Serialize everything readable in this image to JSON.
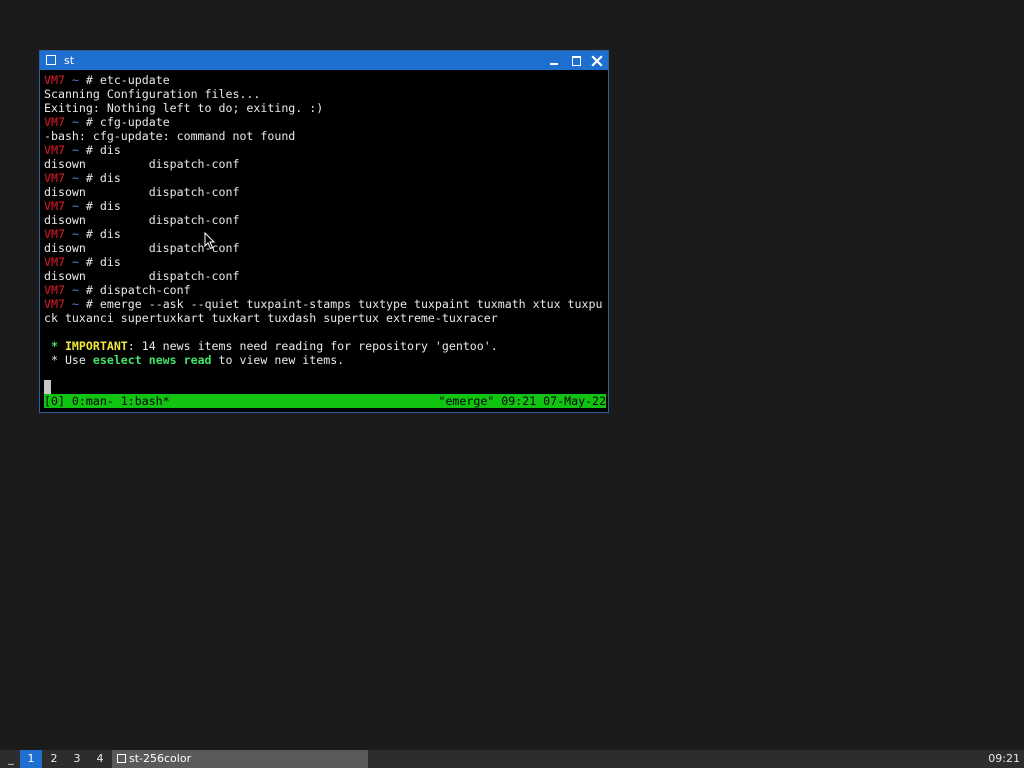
{
  "window": {
    "title": "st",
    "icons": {
      "app": "window-icon",
      "minimize": "minimize-icon",
      "maximize": "maximize-icon",
      "close": "close-icon"
    }
  },
  "prompt": {
    "host": "VM7",
    "tilde": "~",
    "hash": "#"
  },
  "terminal": {
    "lines": [
      {
        "kind": "prompt",
        "cmd": " etc-update"
      },
      {
        "kind": "text",
        "text": "Scanning Configuration files..."
      },
      {
        "kind": "text",
        "text": "Exiting: Nothing left to do; exiting. :)"
      },
      {
        "kind": "prompt",
        "cmd": " cfg-update"
      },
      {
        "kind": "text",
        "text": "-bash: cfg-update: command not found"
      },
      {
        "kind": "prompt",
        "cmd": " dis"
      },
      {
        "kind": "text",
        "text": "disown         dispatch-conf"
      },
      {
        "kind": "prompt",
        "cmd": " dis"
      },
      {
        "kind": "text",
        "text": "disown         dispatch-conf"
      },
      {
        "kind": "prompt",
        "cmd": " dis"
      },
      {
        "kind": "text",
        "text": "disown         dispatch-conf"
      },
      {
        "kind": "prompt",
        "cmd": " dis"
      },
      {
        "kind": "text",
        "text": "disown         dispatch-conf"
      },
      {
        "kind": "prompt",
        "cmd": " dis"
      },
      {
        "kind": "text",
        "text": "disown         dispatch-conf"
      },
      {
        "kind": "prompt",
        "cmd": " dispatch-conf"
      },
      {
        "kind": "prompt",
        "cmd": " emerge --ask --quiet tuxpaint-stamps tuxtype tuxpaint tuxmath xtux tuxpu"
      },
      {
        "kind": "text",
        "text": "ck tuxanci supertuxkart tuxkart tuxdash supertux extreme-tuxracer"
      },
      {
        "kind": "text",
        "text": ""
      },
      {
        "kind": "notice1",
        "pre": " * ",
        "strong": "IMPORTANT",
        "post": ": 14 news items need reading for repository 'gentoo'."
      },
      {
        "kind": "notice2",
        "pre": " * Use ",
        "strong": "eselect news read",
        "post": " to view new items."
      }
    ]
  },
  "tmux": {
    "left": "[0] 0:man- 1:bash*",
    "right": "\"emerge\" 09:21 07-May-22"
  },
  "colors": {
    "host": "#e0182a",
    "tilde": "#4f7dd9",
    "status_bar": "#11c411",
    "titlebar": "#1e6fd0",
    "important": "#f0e93c",
    "eselect": "#43e36a"
  },
  "taskbar": {
    "minimize_label": "_",
    "workspaces": [
      "1",
      "2",
      "3",
      "4"
    ],
    "active_workspace": "1",
    "task_label": "st-256color",
    "clock": "09:21"
  }
}
